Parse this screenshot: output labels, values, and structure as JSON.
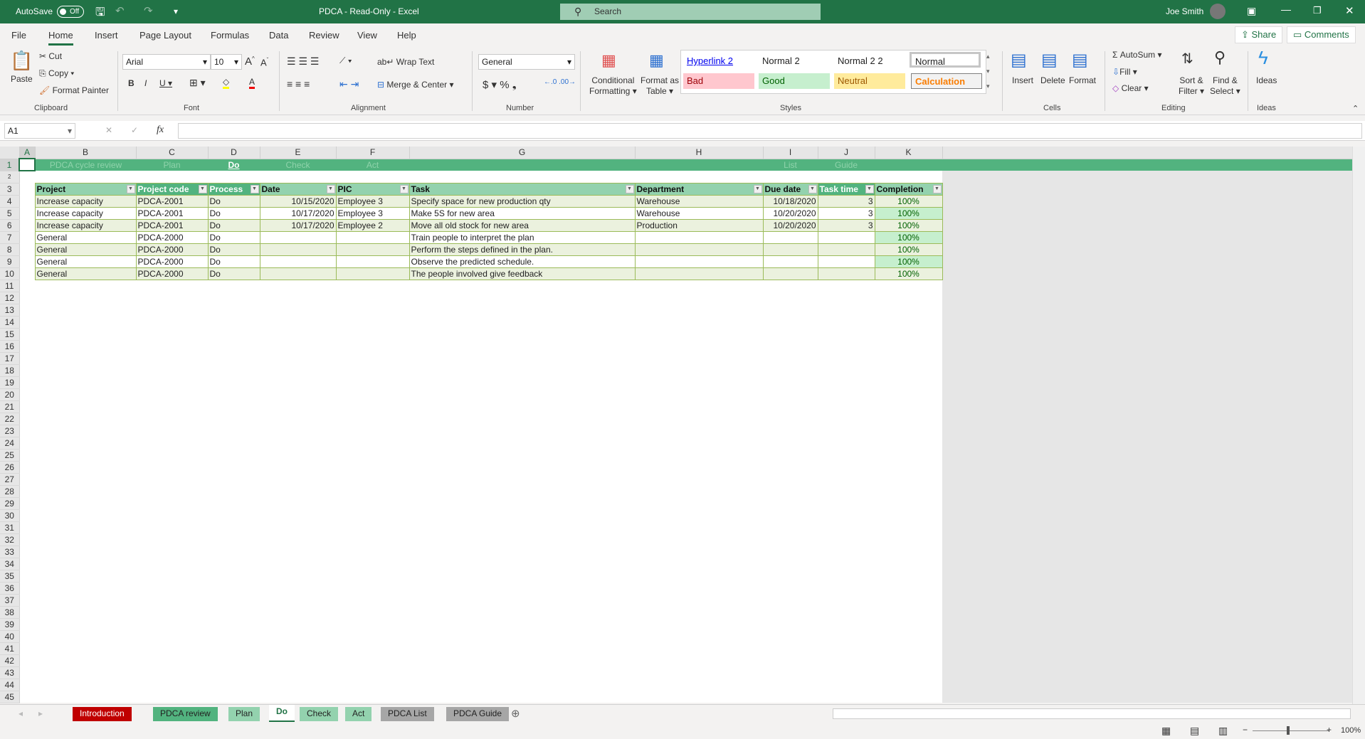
{
  "titlebar": {
    "autosave": "AutoSave",
    "toggle": "Off",
    "title": "PDCA  -  Read-Only  -  Excel",
    "search": "Search",
    "user": "Joe Smith"
  },
  "menu": {
    "tabs": [
      "File",
      "Home",
      "Insert",
      "Page Layout",
      "Formulas",
      "Data",
      "Review",
      "View",
      "Help"
    ],
    "share": "Share",
    "comments": "Comments"
  },
  "ribbon": {
    "clipboard": {
      "paste": "Paste",
      "cut": "Cut",
      "copy": "Copy",
      "format_painter": "Format Painter",
      "label": "Clipboard"
    },
    "font": {
      "name": "Arial",
      "size": "10",
      "label": "Font"
    },
    "alignment": {
      "wrap": "Wrap Text",
      "merge": "Merge & Center",
      "label": "Alignment"
    },
    "number": {
      "format": "General",
      "label": "Number"
    },
    "styles": {
      "cond1": "Conditional",
      "cond2": "Formatting",
      "fat1": "Format as",
      "fat2": "Table",
      "hyperlink": "Hyperlink 2",
      "normal2": "Normal 2",
      "normal22": "Normal 2 2",
      "normal": "Normal",
      "bad": "Bad",
      "good": "Good",
      "neutral": "Neutral",
      "calculation": "Calculation",
      "label": "Styles"
    },
    "cells": {
      "insert": "Insert",
      "delete": "Delete",
      "format": "Format",
      "label": "Cells"
    },
    "editing": {
      "autosum": "AutoSum",
      "fill": "Fill",
      "clear": "Clear",
      "sort1": "Sort &",
      "sort2": "Filter",
      "find1": "Find &",
      "find2": "Select",
      "label": "Editing"
    },
    "ideas": {
      "ideas": "Ideas",
      "label": "Ideas"
    }
  },
  "formula_bar": {
    "name_box": "A1",
    "fx": "fx",
    "formula": ""
  },
  "sheet": {
    "columns": [
      "A",
      "B",
      "C",
      "D",
      "E",
      "F",
      "G",
      "H",
      "I",
      "J",
      "K"
    ],
    "row1": [
      "",
      "PDCA cycle review",
      "Plan",
      "Do",
      "Check",
      "Act",
      "",
      "",
      "List",
      "Guide",
      ""
    ],
    "headers": [
      "Project",
      "Project code",
      "Process",
      "Date",
      "PIC",
      "Task",
      "Department",
      "Due date",
      "Task time",
      "Completion"
    ],
    "rows": [
      [
        "Increase capacity",
        "PDCA-2001",
        "Do",
        "10/15/2020",
        "Employee 3",
        "Specify space for new production qty",
        "Warehouse",
        "10/18/2020",
        "3",
        "100%"
      ],
      [
        "Increase capacity",
        "PDCA-2001",
        "Do",
        "10/17/2020",
        "Employee 3",
        "Make 5S for new area",
        "Warehouse",
        "10/20/2020",
        "3",
        "100%"
      ],
      [
        "Increase capacity",
        "PDCA-2001",
        "Do",
        "10/17/2020",
        "Employee 2",
        "Move all old stock for new area",
        "Production",
        "10/20/2020",
        "3",
        "100%"
      ],
      [
        "General",
        "PDCA-2000",
        "Do",
        "",
        "",
        "Train people to interpret the plan",
        "",
        "",
        "",
        "100%"
      ],
      [
        "General",
        "PDCA-2000",
        "Do",
        "",
        "",
        "Perform the steps defined in the plan.",
        "",
        "",
        "",
        "100%"
      ],
      [
        "General",
        "PDCA-2000",
        "Do",
        "",
        "",
        "Observe the predicted schedule.",
        "",
        "",
        "",
        "100%"
      ],
      [
        "General",
        "PDCA-2000",
        "Do",
        "",
        "",
        "The people involved give feedback",
        "",
        "",
        "",
        "100%"
      ]
    ],
    "row_count": 45
  },
  "sheet_tabs": [
    {
      "label": "Introduction",
      "color": "#c00000",
      "text": "#ffffff"
    },
    {
      "label": "PDCA review",
      "color": "#52b37f",
      "text": "#222222"
    },
    {
      "label": "Plan",
      "color": "#93d2ae",
      "text": "#222222"
    },
    {
      "label": "Do",
      "color": "#ffffff",
      "text": "#217346"
    },
    {
      "label": "Check",
      "color": "#93d2ae",
      "text": "#222222"
    },
    {
      "label": "Act",
      "color": "#93d2ae",
      "text": "#222222"
    },
    {
      "label": "PDCA List",
      "color": "#a6a6a6",
      "text": "#222222"
    },
    {
      "label": "PDCA Guide",
      "color": "#a6a6a6",
      "text": "#222222"
    }
  ],
  "status": {
    "zoom": "100%"
  }
}
